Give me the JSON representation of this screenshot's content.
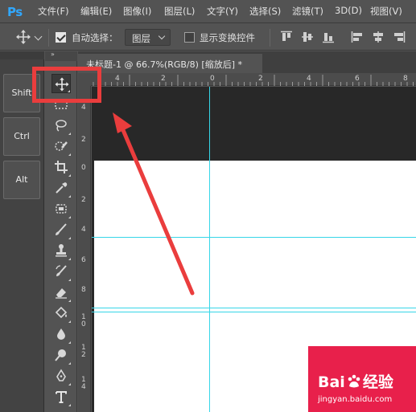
{
  "app": {
    "logo_text": "Ps"
  },
  "menu": [
    {
      "label": "文件(F)"
    },
    {
      "label": "编辑(E)"
    },
    {
      "label": "图像(I)"
    },
    {
      "label": "图层(L)"
    },
    {
      "label": "文字(Y)"
    },
    {
      "label": "选择(S)"
    },
    {
      "label": "滤镜(T)"
    },
    {
      "label": "3D(D)"
    },
    {
      "label": "视图(V)"
    }
  ],
  "options_bar": {
    "auto_select_label": "自动选择：",
    "auto_select_checked": true,
    "auto_select_target": "图层",
    "show_transform_label": "显示变换控件",
    "show_transform_checked": false
  },
  "dock": {
    "collapse_glyph": "»",
    "modifier_keys": [
      {
        "label": "Shift"
      },
      {
        "label": "Ctrl"
      },
      {
        "label": "Alt"
      }
    ]
  },
  "document_tab": {
    "title": "未标题-1 @ 66.7%(RGB/8) [缩放后] *"
  },
  "rulers": {
    "top_numbers": [
      "4",
      "2",
      "0",
      "2",
      "4",
      "6",
      "8"
    ],
    "left_numbers": [
      "4",
      "2",
      "0",
      "2",
      "4",
      "6",
      "8",
      "1\n0",
      "1\n2",
      "1\n4"
    ]
  },
  "tools": [
    {
      "name": "move-tool-icon",
      "active": true
    },
    {
      "name": "marquee-tool-icon"
    },
    {
      "name": "lasso-tool-icon"
    },
    {
      "name": "quick-selection-tool-icon"
    },
    {
      "name": "crop-tool-icon"
    },
    {
      "name": "eyedropper-tool-icon"
    },
    {
      "name": "spot-healing-tool-icon"
    },
    {
      "name": "brush-tool-icon"
    },
    {
      "name": "clone-stamp-tool-icon"
    },
    {
      "name": "history-brush-tool-icon"
    },
    {
      "name": "eraser-tool-icon"
    },
    {
      "name": "paint-bucket-tool-icon"
    },
    {
      "name": "blur-tool-icon"
    },
    {
      "name": "dodge-tool-icon"
    },
    {
      "name": "pen-tool-icon"
    },
    {
      "name": "type-tool-icon"
    }
  ],
  "watermark": {
    "brand_prefix": "Bai",
    "brand_suffix": "经验",
    "url": "jingyan.baidu.com"
  },
  "colors": {
    "annotation_red": "#ea3d3d",
    "guide_cyan": "#36d6e8",
    "logo_blue": "#31a8ff",
    "watermark_red": "#e8204b"
  }
}
